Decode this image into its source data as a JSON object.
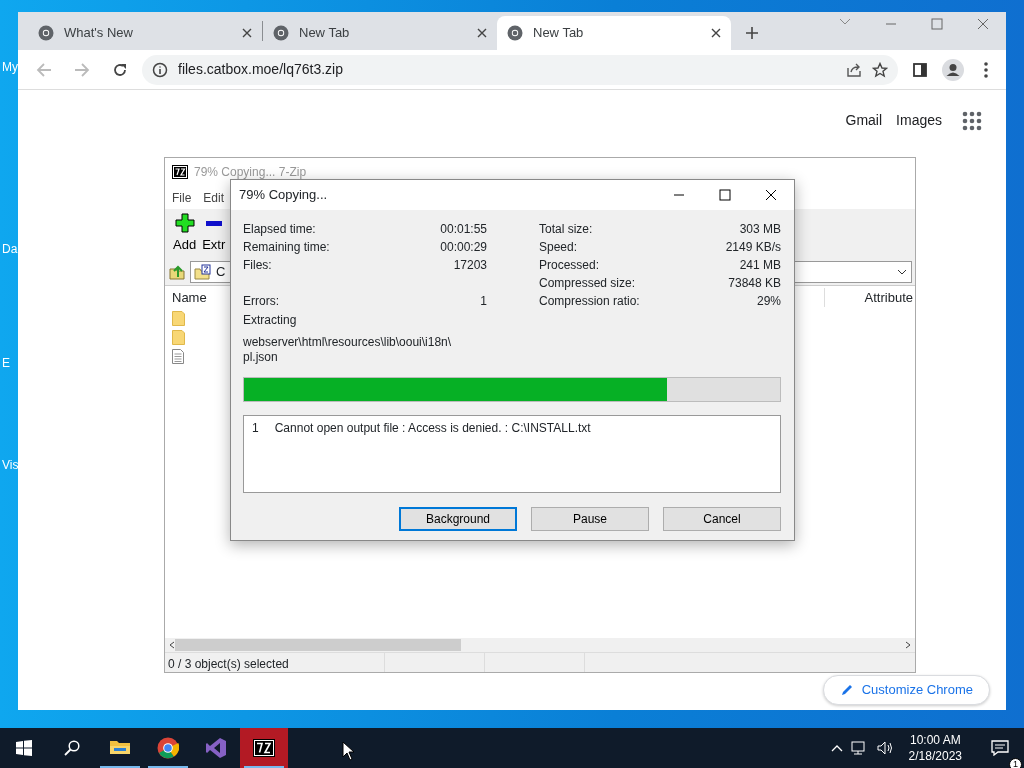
{
  "desktop": {
    "icon_labels": [
      "My",
      "Da",
      "E",
      "Vis"
    ]
  },
  "browser": {
    "tabs": [
      {
        "title": "What's New",
        "selected": false
      },
      {
        "title": "New Tab",
        "selected": false
      },
      {
        "title": "New Tab",
        "selected": true
      }
    ],
    "url": "files.catbox.moe/lq76t3.zip",
    "links": [
      "Gmail",
      "Images"
    ],
    "customize_button": "Customize Chrome"
  },
  "archive_window": {
    "title": "79% Copying... 7-Zip",
    "menu": [
      "File",
      "Edit"
    ],
    "toolbar": [
      {
        "kind": "add",
        "label": "Add"
      },
      {
        "kind": "extract",
        "label": "Extr"
      }
    ],
    "path": "C",
    "columns": [
      "Name",
      "Attribute"
    ],
    "rows": [
      {
        "kind": "folder"
      },
      {
        "kind": "folder"
      },
      {
        "kind": "file"
      }
    ],
    "status": "0 / 3 object(s) selected"
  },
  "progress_dialog": {
    "title": "79% Copying...",
    "left_stats": [
      {
        "label": "Elapsed time:",
        "value": "00:01:55"
      },
      {
        "label": "Remaining time:",
        "value": "00:00:29"
      },
      {
        "label": "Files:",
        "value": "17203"
      },
      {
        "label": "Errors:",
        "value": "1"
      }
    ],
    "right_stats": [
      {
        "label": "Total size:",
        "value": "303 MB"
      },
      {
        "label": "Speed:",
        "value": "2149 KB/s"
      },
      {
        "label": "Processed:",
        "value": "241 MB"
      },
      {
        "label": "Compressed size:",
        "value": "73848 KB"
      },
      {
        "label": "Compression ratio:",
        "value": "29%"
      }
    ],
    "operation": "Extracting",
    "current_file": "webserver\\html\\resources\\lib\\ooui\\i18n\\ pl.json",
    "level": 0.79,
    "errors": [
      {
        "number": "1",
        "message": "Cannot open output file : Access is denied. : C:\\INSTALL.txt"
      }
    ],
    "buttons": [
      {
        "label": "Background",
        "focused": true
      },
      {
        "label": "Pause",
        "focused": false
      },
      {
        "label": "Cancel",
        "focused": false
      }
    ]
  },
  "taskbar": {
    "apps": [
      {
        "kind": "explorer",
        "running": true,
        "selected": false
      },
      {
        "kind": "chrome",
        "running": true,
        "selected": false
      },
      {
        "kind": "studio",
        "running": false,
        "selected": false
      },
      {
        "kind": "sevenzip",
        "running": true,
        "selected": true
      }
    ],
    "time": "10:00 AM",
    "date": "2/18/2023",
    "notifications": "1"
  }
}
